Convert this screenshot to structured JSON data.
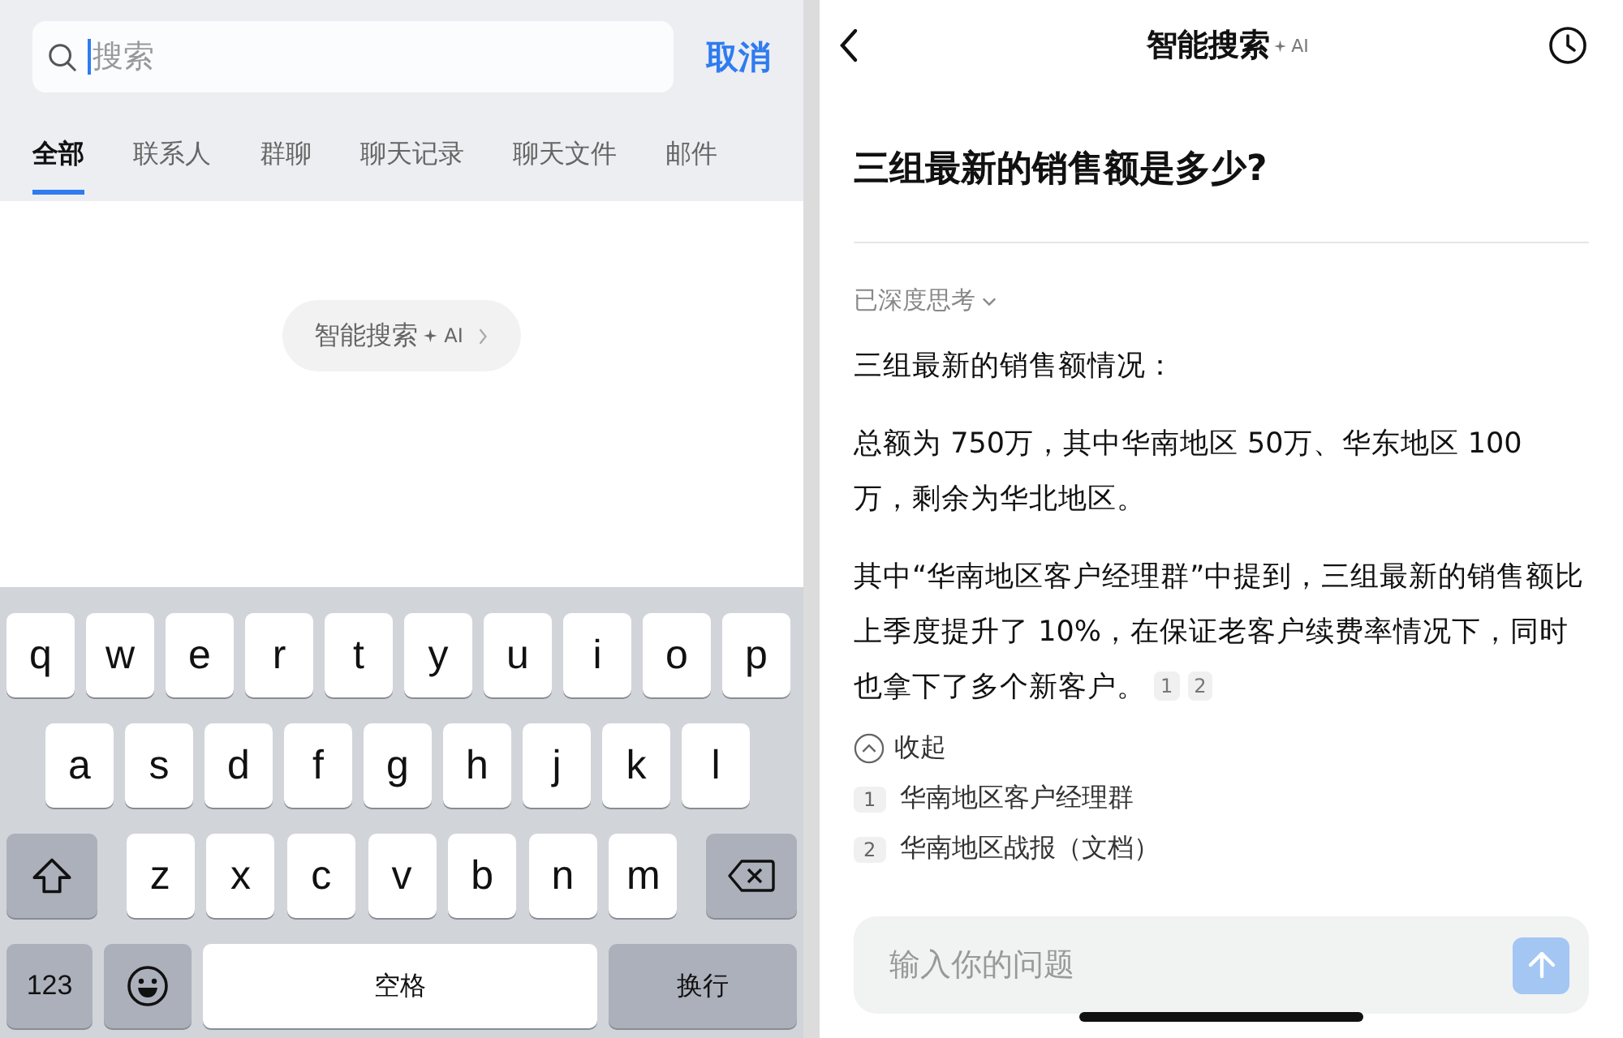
{
  "search_screen": {
    "search": {
      "placeholder": "搜索"
    },
    "cancel": "取消",
    "tabs": [
      {
        "label": "全部",
        "selected": true
      },
      {
        "label": "联系人",
        "selected": false
      },
      {
        "label": "群聊",
        "selected": false
      },
      {
        "label": "聊天记录",
        "selected": false
      },
      {
        "label": "聊天文件",
        "selected": false
      },
      {
        "label": "邮件",
        "selected": false
      }
    ],
    "ai_button": {
      "label": "智能搜索",
      "badge": "AI"
    },
    "keyboard": [
      {
        "keys": [
          {
            "kind": "letter",
            "label": "q"
          },
          {
            "kind": "letter",
            "label": "w"
          },
          {
            "kind": "letter",
            "label": "e"
          },
          {
            "kind": "letter",
            "label": "r"
          },
          {
            "kind": "letter",
            "label": "t"
          },
          {
            "kind": "letter",
            "label": "y"
          },
          {
            "kind": "letter",
            "label": "u"
          },
          {
            "kind": "letter",
            "label": "i"
          },
          {
            "kind": "letter",
            "label": "o"
          },
          {
            "kind": "letter",
            "label": "p"
          }
        ]
      },
      {
        "keys": [
          {
            "kind": "letter",
            "label": "a"
          },
          {
            "kind": "letter",
            "label": "s"
          },
          {
            "kind": "letter",
            "label": "d"
          },
          {
            "kind": "letter",
            "label": "f"
          },
          {
            "kind": "letter",
            "label": "g"
          },
          {
            "kind": "letter",
            "label": "h"
          },
          {
            "kind": "letter",
            "label": "j"
          },
          {
            "kind": "letter",
            "label": "k"
          },
          {
            "kind": "letter",
            "label": "l"
          }
        ]
      },
      {
        "keys": [
          {
            "kind": "shift"
          },
          {
            "kind": "letter",
            "label": "z"
          },
          {
            "kind": "letter",
            "label": "x"
          },
          {
            "kind": "letter",
            "label": "c"
          },
          {
            "kind": "letter",
            "label": "v"
          },
          {
            "kind": "letter",
            "label": "b"
          },
          {
            "kind": "letter",
            "label": "n"
          },
          {
            "kind": "letter",
            "label": "m"
          },
          {
            "kind": "delete"
          }
        ]
      },
      {
        "keys": [
          {
            "kind": "numbers",
            "label": "123"
          },
          {
            "kind": "emoji"
          },
          {
            "kind": "space",
            "label": "空格"
          },
          {
            "kind": "return",
            "label": "换行"
          }
        ]
      }
    ]
  },
  "ai_screen": {
    "header": {
      "title": "智能搜索",
      "badge": "AI"
    },
    "question": "三组最新的销售额是多少?",
    "thinking": "已深度思考",
    "answer": [
      {
        "text": "三组最新的销售额情况："
      },
      {
        "text": "总额为 750万，其中华南地区 50万、华东地区 100 万，剩余为华北地区。"
      },
      {
        "text": "其中“华南地区客户经理群”中提到，三组最新的销售额比上季度提升了 10%，在保证老客户续费率情况下，同时也拿下了多个新客户。",
        "citations": [
          "1",
          "2"
        ]
      }
    ],
    "collapse": "收起",
    "references": [
      {
        "index": "1",
        "title": "华南地区客户经理群"
      },
      {
        "index": "2",
        "title": "华南地区战报（文档）"
      }
    ],
    "input": {
      "placeholder": "输入你的问题"
    }
  }
}
